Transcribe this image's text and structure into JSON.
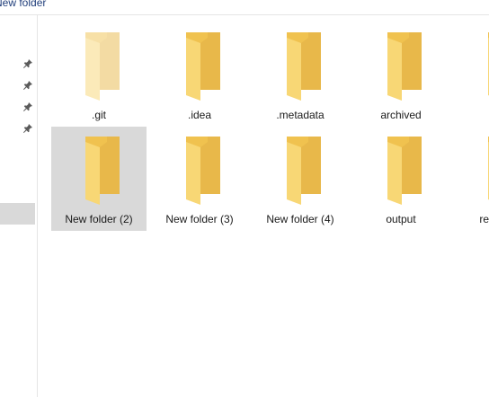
{
  "window": {
    "breadcrumb": "New folder"
  },
  "nav_pane": {
    "pinned_icons": [
      "pin-icon",
      "pin-icon",
      "pin-icon",
      "pin-icon"
    ]
  },
  "folders": [
    {
      "name": ".git",
      "hidden": true
    },
    {
      "name": ".idea",
      "hidden": false
    },
    {
      "name": ".metadata",
      "hidden": false
    },
    {
      "name": "archived",
      "hidden": false
    },
    {
      "name": "",
      "hidden": false
    },
    {
      "name": "New folder (2)",
      "hidden": false,
      "selected": true
    },
    {
      "name": "New folder (3)",
      "hidden": false
    },
    {
      "name": "New folder (4)",
      "hidden": false
    },
    {
      "name": "output",
      "hidden": false
    },
    {
      "name": "re",
      "hidden": false
    }
  ],
  "colors": {
    "folder_back": "#e8b84a",
    "folder_front": "#f8d775",
    "selection": "#d9d9d9"
  }
}
